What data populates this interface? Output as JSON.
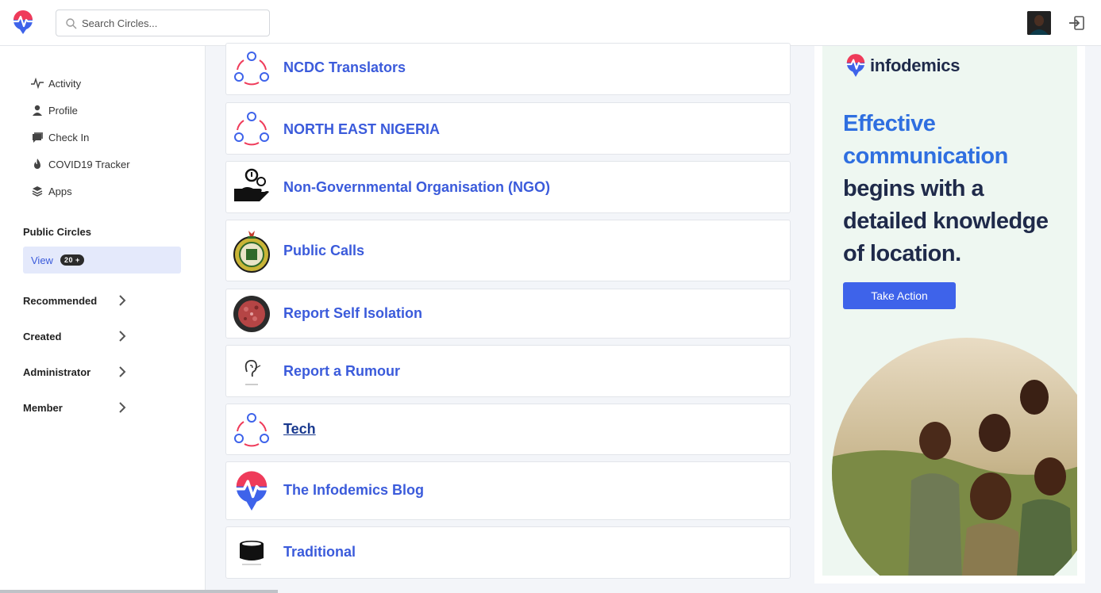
{
  "header": {
    "search_placeholder": "Search Circles..."
  },
  "sidebar": {
    "nav": [
      {
        "label": "Activity",
        "icon": "activity-icon"
      },
      {
        "label": "Profile",
        "icon": "user-icon"
      },
      {
        "label": "Check In",
        "icon": "chat-icon"
      },
      {
        "label": "COVID19 Tracker",
        "icon": "flame-icon"
      },
      {
        "label": "Apps",
        "icon": "layers-icon"
      }
    ],
    "public_circles_title": "Public Circles",
    "view_label": "View",
    "view_badge": "20 +",
    "sections": [
      {
        "label": "Recommended"
      },
      {
        "label": "Created"
      },
      {
        "label": "Administrator"
      },
      {
        "label": "Member"
      }
    ]
  },
  "circles": [
    {
      "title": "NCDC Translators",
      "icon": "circle-people-icon"
    },
    {
      "title": "NORTH EAST NIGERIA",
      "icon": "circle-people-icon"
    },
    {
      "title": "Non-Governmental Organisation (NGO)",
      "icon": "hand-coin-icon"
    },
    {
      "title": "Public Calls",
      "icon": "nysc-seal-icon"
    },
    {
      "title": "Report Self Isolation",
      "icon": "virus-icon"
    },
    {
      "title": "Report a Rumour",
      "icon": "ear-icon"
    },
    {
      "title": "Tech",
      "icon": "circle-people-icon"
    },
    {
      "title": "The Infodemics Blog",
      "icon": "infodemics-logo-icon"
    },
    {
      "title": "Traditional",
      "icon": "hat-icon"
    }
  ],
  "ad": {
    "brand": "infodemics",
    "headline_blue_1": "Effective",
    "headline_blue_2": "communication",
    "headline_dark_1": "begins with a",
    "headline_dark_2": "detailed knowledge",
    "headline_dark_3": "of location.",
    "cta": "Take Action"
  },
  "colors": {
    "accent": "#3b5bdb",
    "brand_red": "#ef3b5a",
    "brand_blue": "#2f6fe0",
    "ad_bg": "#eef7f1"
  }
}
